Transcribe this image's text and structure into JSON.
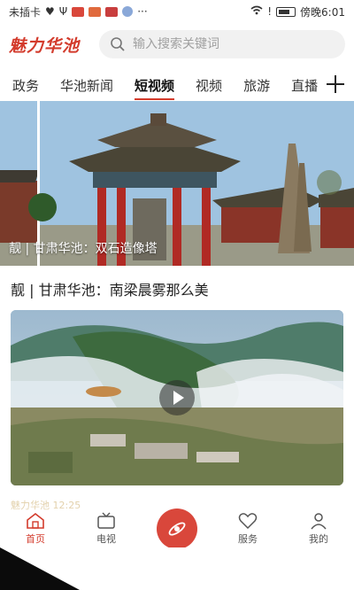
{
  "status_bar": {
    "carrier": "未插卡",
    "time": "傍晚6:01"
  },
  "header": {
    "logo": "魅力华池",
    "search": {
      "placeholder": "输入搜索关键词",
      "icon": "search-icon"
    }
  },
  "tabs": [
    {
      "label": "政务",
      "active": false
    },
    {
      "label": "华池新闻",
      "active": false
    },
    {
      "label": "短视频",
      "active": true
    },
    {
      "label": "视频",
      "active": false
    },
    {
      "label": "旅游",
      "active": false
    },
    {
      "label": "直播",
      "active": false
    }
  ],
  "tab_add_icon": "plus-icon",
  "hero": {
    "caption": "靓 | 甘肃华池：双石造像塔"
  },
  "article": {
    "title": "靓 | 甘肃华池：南梁晨雾那么美",
    "meta": "魅力华池 12:25"
  },
  "bottom_nav": [
    {
      "label": "首页",
      "icon": "home-icon",
      "active": true
    },
    {
      "label": "电视",
      "icon": "tv-icon",
      "active": false
    },
    {
      "label": "服务",
      "icon": "heart-icon",
      "active": false
    },
    {
      "label": "我的",
      "icon": "user-icon",
      "active": false
    }
  ],
  "colors": {
    "accent": "#d33b2c",
    "fab": "#d9473b"
  }
}
